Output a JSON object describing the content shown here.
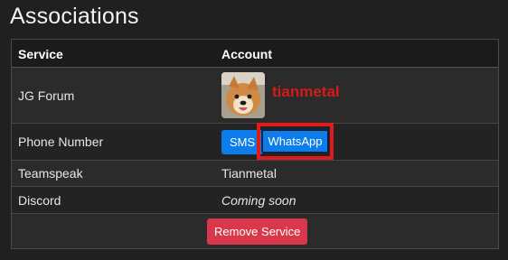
{
  "page": {
    "title": "Associations"
  },
  "table": {
    "headers": {
      "service": "Service",
      "account": "Account"
    },
    "rows": [
      {
        "service": "JG Forum",
        "account": "tianmetal"
      },
      {
        "service": "Phone Number",
        "buttons": {
          "sms": "SMS",
          "whatsapp": "WhatsApp"
        }
      },
      {
        "service": "Teamspeak",
        "account": "Tianmetal"
      },
      {
        "service": "Discord",
        "account": "Coming soon"
      }
    ],
    "remove_label": "Remove Service"
  },
  "colors": {
    "background": "#202020",
    "primary_button": "#0d7dec",
    "danger_button": "#d9384a",
    "highlight_box": "#e11a1a",
    "username_red": "#d41b1b"
  },
  "icons": {
    "avatar": "dog-avatar-image"
  }
}
